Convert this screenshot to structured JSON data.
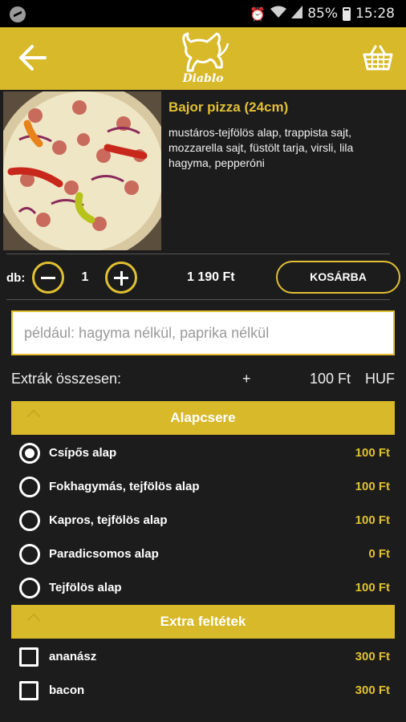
{
  "status_bar": {
    "icons": [
      "messenger-icon",
      "alarm-icon",
      "wifi-icon",
      "signal-icon",
      "battery-icon"
    ],
    "battery": "85%",
    "time": "15:28"
  },
  "app_bar": {
    "logo_text": "Diablo",
    "color": "#d8b92a"
  },
  "product": {
    "title": "Bajor pizza (24cm)",
    "description": "mustáros-tejfölös alap, trappista sajt, mozzarella sajt, füstölt tarja, virsli, lila hagyma, pepperóni"
  },
  "order": {
    "qty_label": "db:",
    "quantity": "1",
    "price": "1 190 Ft",
    "cart_button": "KOSÁRBA"
  },
  "note": {
    "placeholder": "például: hagyma nélkül, paprika nélkül"
  },
  "extras": {
    "label": "Extrák összesen:",
    "plus": "+",
    "amount": "100 Ft",
    "currency": "HUF"
  },
  "sections": [
    {
      "title": "Alapcsere",
      "options": [
        {
          "label": "Csípős alap",
          "price": "100 Ft",
          "checked": true
        },
        {
          "label": "Fokhagymás, tejfölös alap",
          "price": "100 Ft",
          "checked": false
        },
        {
          "label": "Kapros, tejfölös alap",
          "price": "100 Ft",
          "checked": false
        },
        {
          "label": "Paradicsomos alap",
          "price": "0 Ft",
          "checked": false
        },
        {
          "label": "Tejfölös alap",
          "price": "100 Ft",
          "checked": false
        }
      ]
    },
    {
      "title": "Extra feltétek",
      "options": [
        {
          "label": "ananász",
          "price": "300 Ft",
          "checked": false
        },
        {
          "label": "bacon",
          "price": "300 Ft",
          "checked": false
        }
      ]
    }
  ],
  "colors": {
    "accent": "#e1c032",
    "background": "#1c1c1c"
  }
}
